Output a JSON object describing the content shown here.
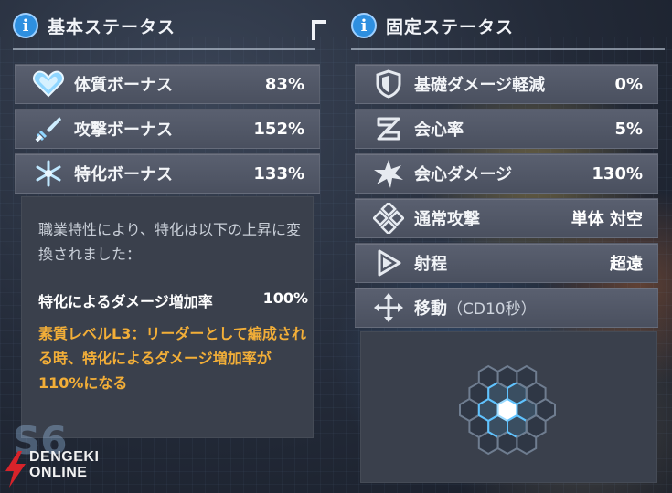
{
  "colors": {
    "accent_blue": "#2e8fe0",
    "orange_text": "#f2ae38",
    "row_bg": "#4f5564",
    "panel_bg": "#3a404c"
  },
  "left_panel": {
    "title": "基本ステータス",
    "info_icon": "i",
    "rows": [
      {
        "icon": "heart-icon",
        "label": "体質ボーナス",
        "value": "83%"
      },
      {
        "icon": "sword-icon",
        "label": "攻撃ボーナス",
        "value": "152%"
      },
      {
        "icon": "snowflake-icon",
        "label": "特化ボーナス",
        "value": "133%"
      }
    ],
    "detail": {
      "intro": "職業特性により、特化は以下の上昇に変換されました：",
      "stat_label": "特化によるダメージ増加率",
      "stat_value": "100%",
      "note": "素質レベルL3：リーダーとして編成される時、特化によるダメージ増加率が110%になる"
    }
  },
  "right_panel": {
    "title": "固定ステータス",
    "info_icon": "i",
    "rows": [
      {
        "icon": "shield-icon",
        "label": "基礎ダメージ軽減",
        "value": "0%"
      },
      {
        "icon": "crit-rate-icon",
        "label": "会心率",
        "value": "5%"
      },
      {
        "icon": "burst-icon",
        "label": "会心ダメージ",
        "value": "130%"
      },
      {
        "icon": "diamond-grid-icon",
        "label": "通常攻撃",
        "value": "単体 対空"
      },
      {
        "icon": "range-icon",
        "label": "射程",
        "value": "超遠"
      },
      {
        "icon": "move-arrows-icon",
        "label": "移動",
        "sub": "（CD10秒）"
      }
    ]
  },
  "watermark": {
    "line1": "DENGEKI",
    "line2": "ONLINE",
    "bg_number": "S6"
  }
}
